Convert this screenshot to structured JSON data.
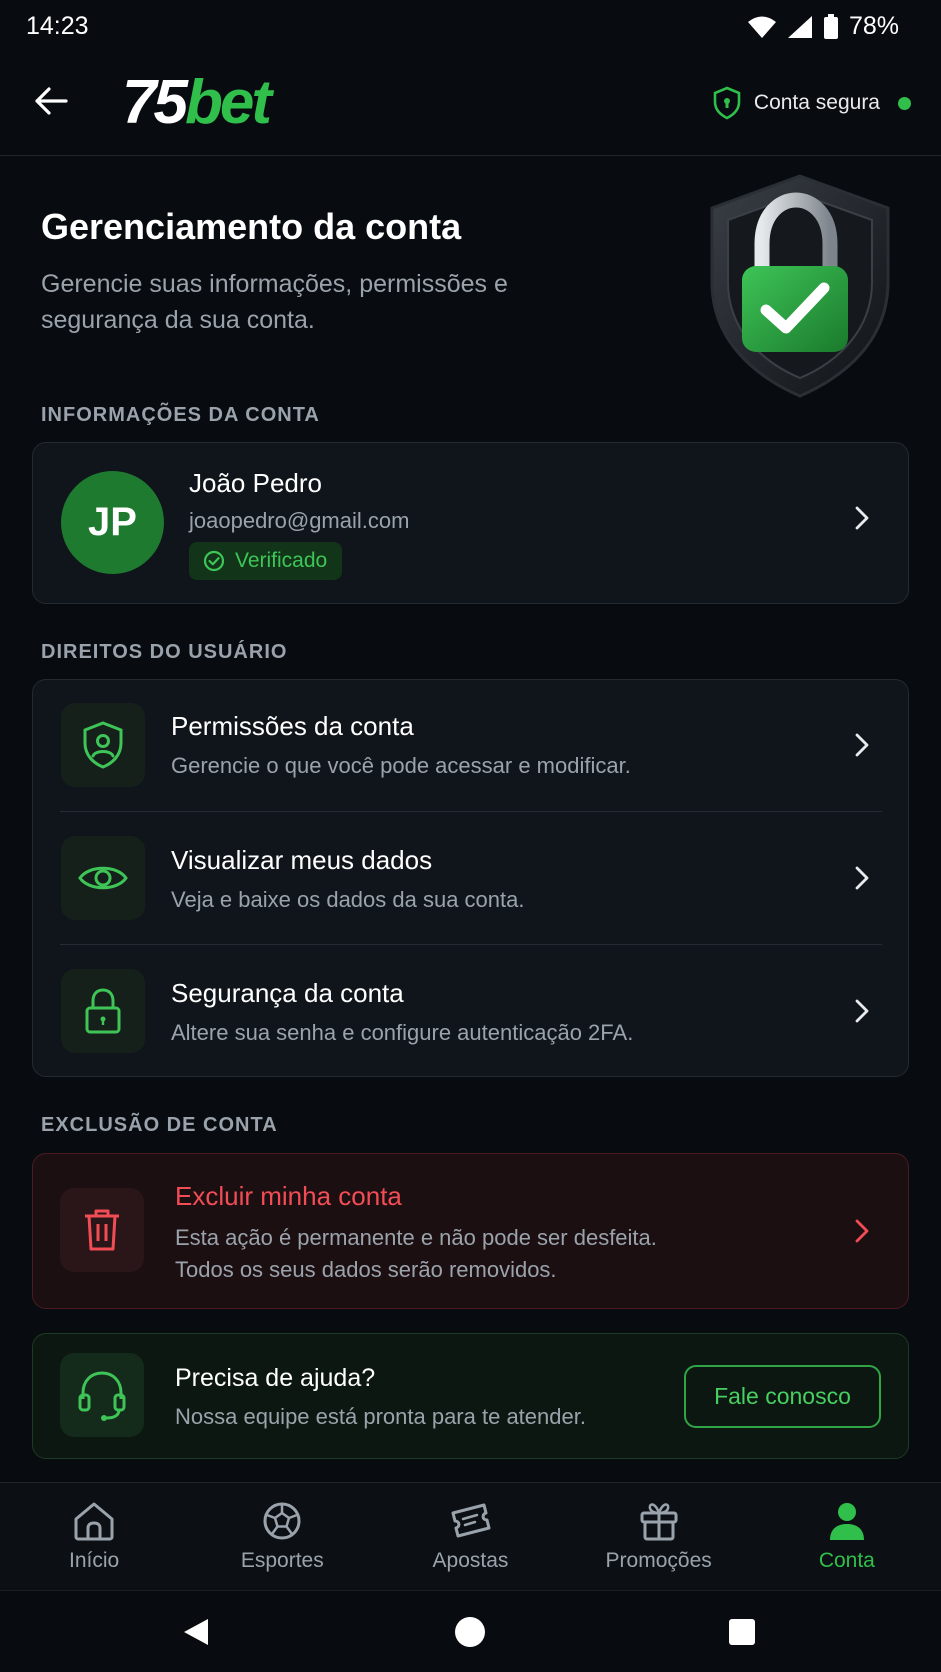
{
  "status_bar": {
    "time": "14:23",
    "battery": "78%"
  },
  "header": {
    "logo_number": "75",
    "logo_brand": "bet",
    "secure_label": "Conta segura",
    "brand_color": "#2fbf4a"
  },
  "hero": {
    "title": "Gerenciamento da conta",
    "subtitle": "Gerencie suas informações, permissões e segurança da sua conta."
  },
  "account_info": {
    "section_label": "INFORMAÇÕES DA CONTA",
    "initials": "JP",
    "name": "João Pedro",
    "email": "joaopedro@gmail.com",
    "badge": "Verificado"
  },
  "user_rights": {
    "section_label": "DIREITOS DO USUÁRIO",
    "items": [
      {
        "title": "Permissões da conta",
        "description": "Gerencie o que você pode acessar e modificar.",
        "icon": "shield-user-icon"
      },
      {
        "title": "Visualizar meus dados",
        "description": "Veja e baixe os dados da sua conta.",
        "icon": "eye-icon"
      },
      {
        "title": "Segurança da conta",
        "description": "Altere sua senha e configure autenticação 2FA.",
        "icon": "lock-icon"
      }
    ]
  },
  "account_deletion": {
    "section_label": "EXCLUSÃO DE CONTA",
    "title": "Excluir minha conta",
    "description_line1": "Esta ação é permanente e não pode ser desfeita.",
    "description_line2": "Todos os seus dados serão removidos.",
    "danger_color": "#f24c55"
  },
  "help": {
    "title": "Precisa de ajuda?",
    "description": "Nossa equipe está pronta para te atender.",
    "button": "Fale conosco"
  },
  "bottom_nav": {
    "items": [
      {
        "label": "Início",
        "icon": "home-icon",
        "active": false
      },
      {
        "label": "Esportes",
        "icon": "soccer-ball-icon",
        "active": false
      },
      {
        "label": "Apostas",
        "icon": "ticket-icon",
        "active": false
      },
      {
        "label": "Promoções",
        "icon": "gift-icon",
        "active": false
      },
      {
        "label": "Conta",
        "icon": "user-icon",
        "active": true
      }
    ]
  }
}
